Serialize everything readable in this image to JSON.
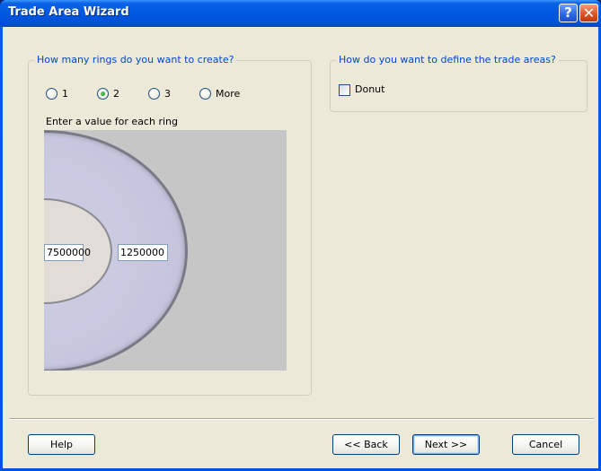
{
  "window": {
    "title": "Trade Area Wizard",
    "help_glyph": "?",
    "close_glyph": "✕"
  },
  "rings_group": {
    "title": "How many rings do you want to create?",
    "options": [
      {
        "label": "1",
        "checked": false
      },
      {
        "label": "2",
        "checked": true
      },
      {
        "label": "3",
        "checked": false
      },
      {
        "label": "More",
        "checked": false
      }
    ],
    "instruction": "Enter a value for each ring",
    "ring_values": [
      "7500000",
      "1250000"
    ]
  },
  "define_group": {
    "title": "How do you want to define the trade areas?",
    "donut_label": "Donut",
    "donut_checked": false
  },
  "buttons": {
    "help": "Help",
    "back": "<< Back",
    "next": "Next >>",
    "cancel": "Cancel"
  },
  "colors": {
    "title_bar": "#0058e0",
    "group_title": "#0046d5",
    "dialog_bg": "#ece9d8"
  }
}
